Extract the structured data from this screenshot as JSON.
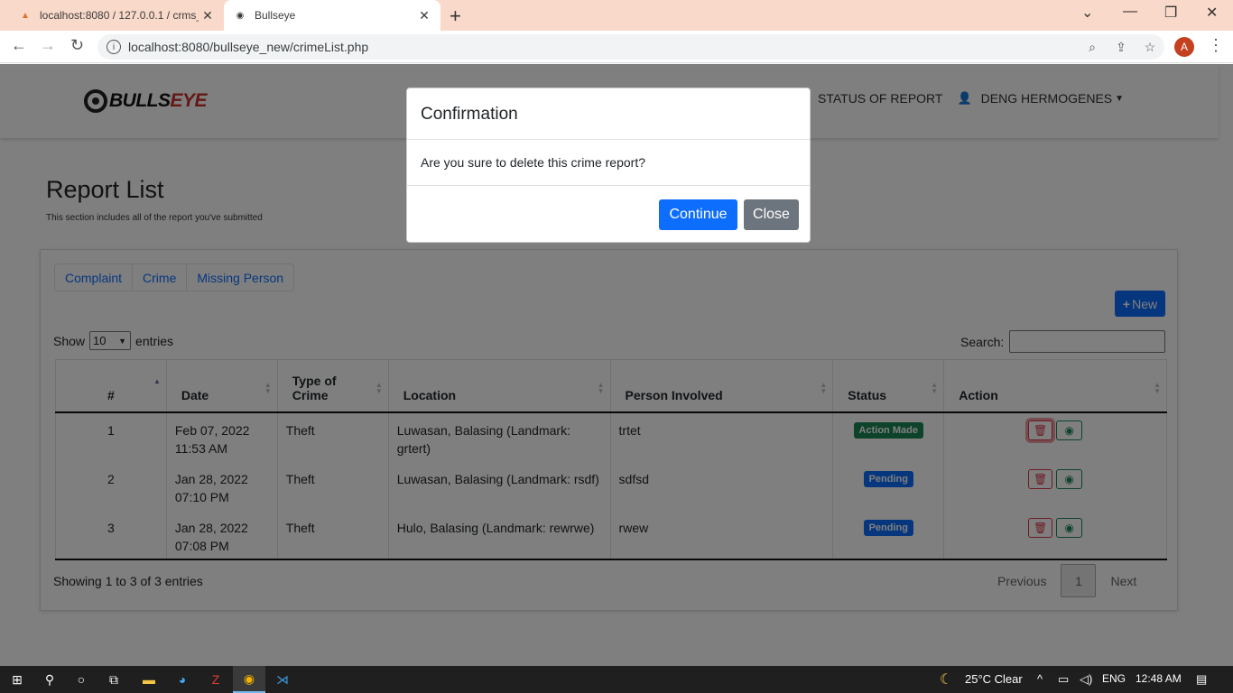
{
  "browser": {
    "tabs": [
      {
        "title": "localhost:8080 / 127.0.0.1 / crms_",
        "icon": "phpmyadmin-icon"
      },
      {
        "title": "Bullseye",
        "icon": "globe-icon"
      }
    ],
    "url": "localhost:8080/bullseye_new/crimeList.php",
    "profile_initial": "A"
  },
  "navbar": {
    "logo_text_a": "BULLS",
    "logo_text_b": "EYE",
    "status_link": "STATUS OF REPORT",
    "user_name": "DENG HERMOGENES"
  },
  "page": {
    "title": "Report List",
    "subtitle": "This section includes all of the report you've submitted"
  },
  "card": {
    "tabs": [
      "Complaint",
      "Crime",
      "Missing Person"
    ],
    "new_button": "New",
    "show_label": "Show",
    "show_value": "10",
    "entries_label": "entries",
    "search_label": "Search:",
    "columns": [
      "#",
      "Date",
      "Type of Crime",
      "Location",
      "Person Involved",
      "Status",
      "Action"
    ],
    "rows": [
      {
        "num": "1",
        "date": "Feb 07, 2022 11:53 AM",
        "type": "Theft",
        "location": "Luwasan, Balasing (Landmark: grtert)",
        "person": "trtet",
        "status": "Action Made"
      },
      {
        "num": "2",
        "date": "Jan 28, 2022 07:10 PM",
        "type": "Theft",
        "location": "Luwasan, Balasing (Landmark: rsdf)",
        "person": "sdfsd",
        "status": "Pending"
      },
      {
        "num": "3",
        "date": "Jan 28, 2022 07:08 PM",
        "type": "Theft",
        "location": "Hulo, Balasing (Landmark: rewrwe)",
        "person": "rwew",
        "status": "Pending"
      }
    ],
    "info": "Showing 1 to 3 of 3 entries",
    "pager": {
      "prev": "Previous",
      "page": "1",
      "next": "Next"
    }
  },
  "modal": {
    "title": "Confirmation",
    "message": "Are you sure to delete this crime report?",
    "continue": "Continue",
    "close": "Close"
  },
  "taskbar": {
    "weather": "25°C  Clear",
    "lang": "ENG",
    "time": "12:48 AM"
  },
  "colors": {
    "primary": "#0d6efd",
    "success": "#198754",
    "danger": "#dc3545",
    "secondary": "#6c757d",
    "tabstrip": "#f9d9c9"
  }
}
